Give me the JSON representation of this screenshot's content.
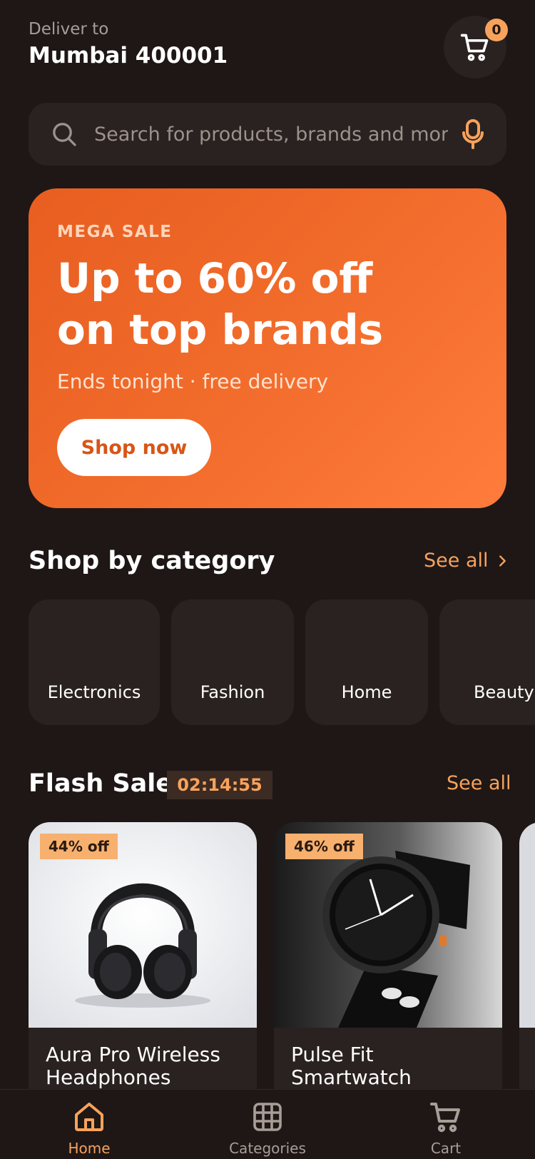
{
  "header": {
    "deliver_label": "Deliver to",
    "location": "Mumbai 400001",
    "cart_count": "0"
  },
  "search": {
    "placeholder": "Search for products, brands and more"
  },
  "banner": {
    "kicker": "MEGA SALE",
    "title_line1": "Up to 60% off",
    "title_line2": "on top brands",
    "subtitle": "Ends tonight · free delivery",
    "cta": "Shop now"
  },
  "categories": {
    "title": "Shop by category",
    "see_all": "See all",
    "items": [
      {
        "label": "Electronics"
      },
      {
        "label": "Fashion"
      },
      {
        "label": "Home"
      },
      {
        "label": "Beauty"
      }
    ]
  },
  "flash_sale": {
    "title": "Flash Sale",
    "timer": "02:14:55",
    "see_all": "See all",
    "products": [
      {
        "discount": "44% off",
        "name": "Aura Pro Wireless Headphones",
        "image_icon": "headphones-image"
      },
      {
        "discount": "46% off",
        "name": "Pulse Fit Smartwatch",
        "image_icon": "smartwatch-image"
      }
    ]
  },
  "bottom_nav": {
    "items": [
      {
        "label": "Home",
        "icon": "home-icon",
        "active": true
      },
      {
        "label": "Categories",
        "icon": "grid-icon",
        "active": false
      },
      {
        "label": "Cart",
        "icon": "cart-icon",
        "active": false
      }
    ]
  },
  "colors": {
    "background": "#1e1716",
    "surface": "#2a2220",
    "accent": "#f7a25c",
    "banner_start": "#e85e20",
    "banner_end": "#ff7c3c"
  }
}
